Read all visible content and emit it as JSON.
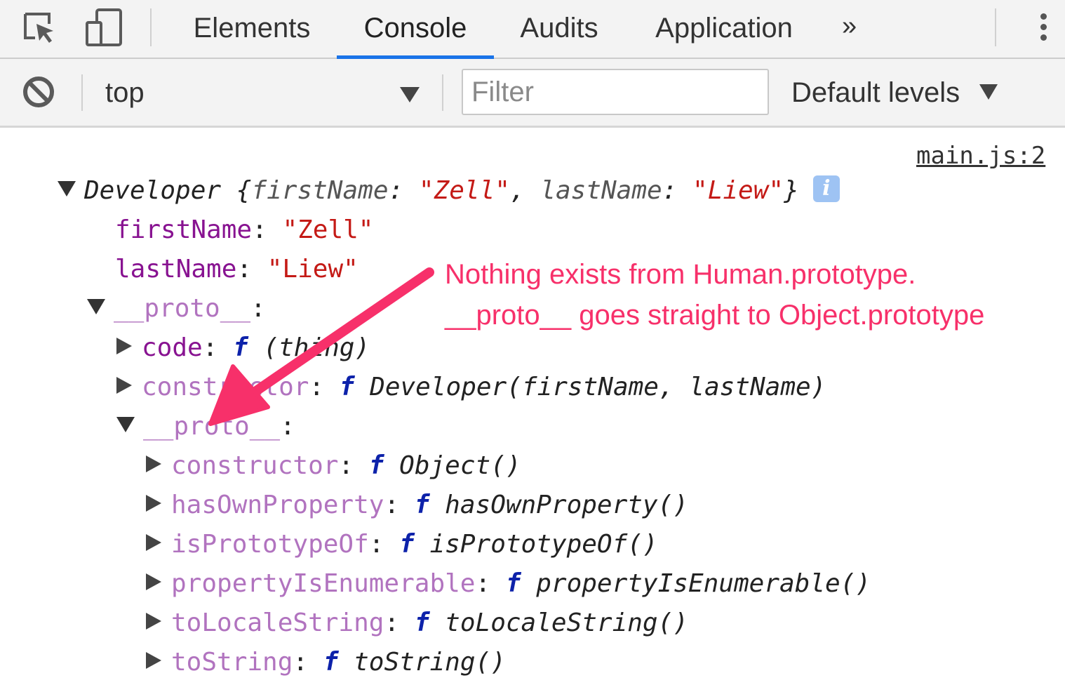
{
  "tabs": [
    {
      "label": "Elements",
      "active": false
    },
    {
      "label": "Console",
      "active": true
    },
    {
      "label": "Audits",
      "active": false
    },
    {
      "label": "Application",
      "active": false
    }
  ],
  "more_tabs_glyph": "»",
  "toolbar": {
    "context_value": "top",
    "filter_placeholder": "Filter",
    "levels_label": "Default levels"
  },
  "console": {
    "source_link": "main.js:2",
    "object_summary": {
      "class_name": "Developer",
      "open_brace": " {",
      "key1": "firstName",
      "val1": "\"Zell\"",
      "sep": ", ",
      "key2": "lastName",
      "val2": "\"Liew\"",
      "close_brace": "}",
      "info": "i"
    },
    "own_props": [
      {
        "key": "firstName",
        "value": "\"Zell\""
      },
      {
        "key": "lastName",
        "value": "\"Liew\""
      }
    ],
    "proto_label": "__proto__",
    "proto_members": [
      {
        "key": "code",
        "sig": "(thing)"
      },
      {
        "key": "constructor",
        "sig": "Developer(firstName, lastName)"
      }
    ],
    "nested_proto_label": "__proto__",
    "object_proto_members": [
      {
        "key": "constructor",
        "sig": "Object()"
      },
      {
        "key": "hasOwnProperty",
        "sig": "hasOwnProperty()"
      },
      {
        "key": "isPrototypeOf",
        "sig": "isPrototypeOf()"
      },
      {
        "key": "propertyIsEnumerable",
        "sig": "propertyIsEnumerable()"
      },
      {
        "key": "toLocaleString",
        "sig": "toLocaleString()"
      },
      {
        "key": "toString",
        "sig": "toString()"
      }
    ],
    "fn_glyph": "f"
  },
  "annotation": {
    "line1": "Nothing exists from Human.prototype.",
    "line2": "__proto__ goes straight to Object.prototype"
  },
  "colors": {
    "annotation": "#f7306a",
    "active_tab_underline": "#1a73e8",
    "own_key": "#881391",
    "inherited_key": "#b173bf",
    "string": "#c41a16",
    "function_f": "#0d22aa"
  }
}
